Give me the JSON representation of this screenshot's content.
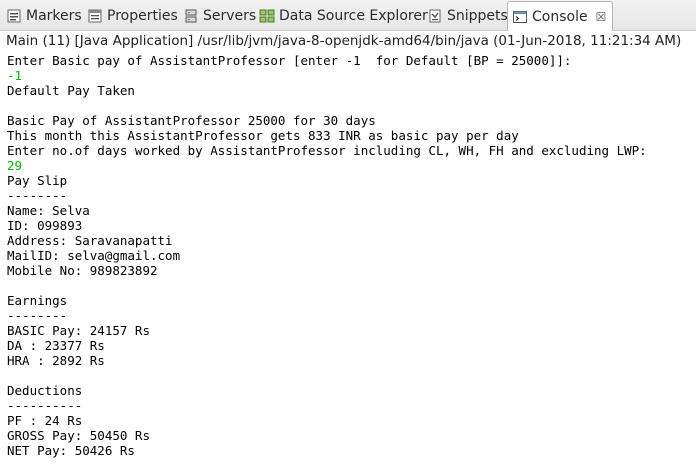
{
  "tabs": [
    {
      "label": "Markers",
      "icon": "markers-icon"
    },
    {
      "label": "Properties",
      "icon": "properties-icon"
    },
    {
      "label": "Servers",
      "icon": "servers-icon"
    },
    {
      "label": "Data Source Explorer",
      "icon": "data-source-explorer-icon"
    },
    {
      "label": "Snippets",
      "icon": "snippets-icon"
    },
    {
      "label": "Console",
      "icon": "console-icon",
      "close": "☒",
      "active": true
    }
  ],
  "process_label": "Main (11) [Java Application] /usr/lib/jvm/java-8-openjdk-amd64/bin/java (01-Jun-2018, 11:21:34 AM)",
  "console": {
    "lines": [
      {
        "text": "Enter Basic pay of AssistantProfessor [enter -1  for Default [BP = 25000]]:",
        "type": "out"
      },
      {
        "text": "-1",
        "type": "in"
      },
      {
        "text": "Default Pay Taken",
        "type": "out"
      },
      {
        "text": "",
        "type": "out"
      },
      {
        "text": "Basic Pay of AssistantProfessor 25000 for 30 days",
        "type": "out"
      },
      {
        "text": "This month this AssistantProfessor gets 833 INR as basic pay per day",
        "type": "out"
      },
      {
        "text": "Enter no.of days worked by AssistantProfessor including CL, WH, FH and excluding LWP:",
        "type": "out"
      },
      {
        "text": "29",
        "type": "in"
      },
      {
        "text": "Pay Slip",
        "type": "out"
      },
      {
        "text": "--------",
        "type": "out"
      },
      {
        "text": "Name: Selva",
        "type": "out"
      },
      {
        "text": "ID: 099893",
        "type": "out"
      },
      {
        "text": "Address: Saravanapatti",
        "type": "out"
      },
      {
        "text": "MailID: selva@gmail.com",
        "type": "out"
      },
      {
        "text": "Mobile No: 989823892",
        "type": "out"
      },
      {
        "text": "",
        "type": "out"
      },
      {
        "text": "Earnings",
        "type": "out"
      },
      {
        "text": "--------",
        "type": "out"
      },
      {
        "text": "BASIC Pay: 24157 Rs",
        "type": "out"
      },
      {
        "text": "DA : 23377 Rs",
        "type": "out"
      },
      {
        "text": "HRA : 2892 Rs",
        "type": "out"
      },
      {
        "text": "",
        "type": "out"
      },
      {
        "text": "Deductions",
        "type": "out"
      },
      {
        "text": "----------",
        "type": "out"
      },
      {
        "text": "PF : 24 Rs",
        "type": "out"
      },
      {
        "text": "GROSS Pay: 50450 Rs",
        "type": "out"
      },
      {
        "text": "NET Pay: 50426 Rs",
        "type": "out"
      }
    ]
  },
  "colors": {
    "input_text": "#00b400",
    "output_text": "#000000"
  }
}
